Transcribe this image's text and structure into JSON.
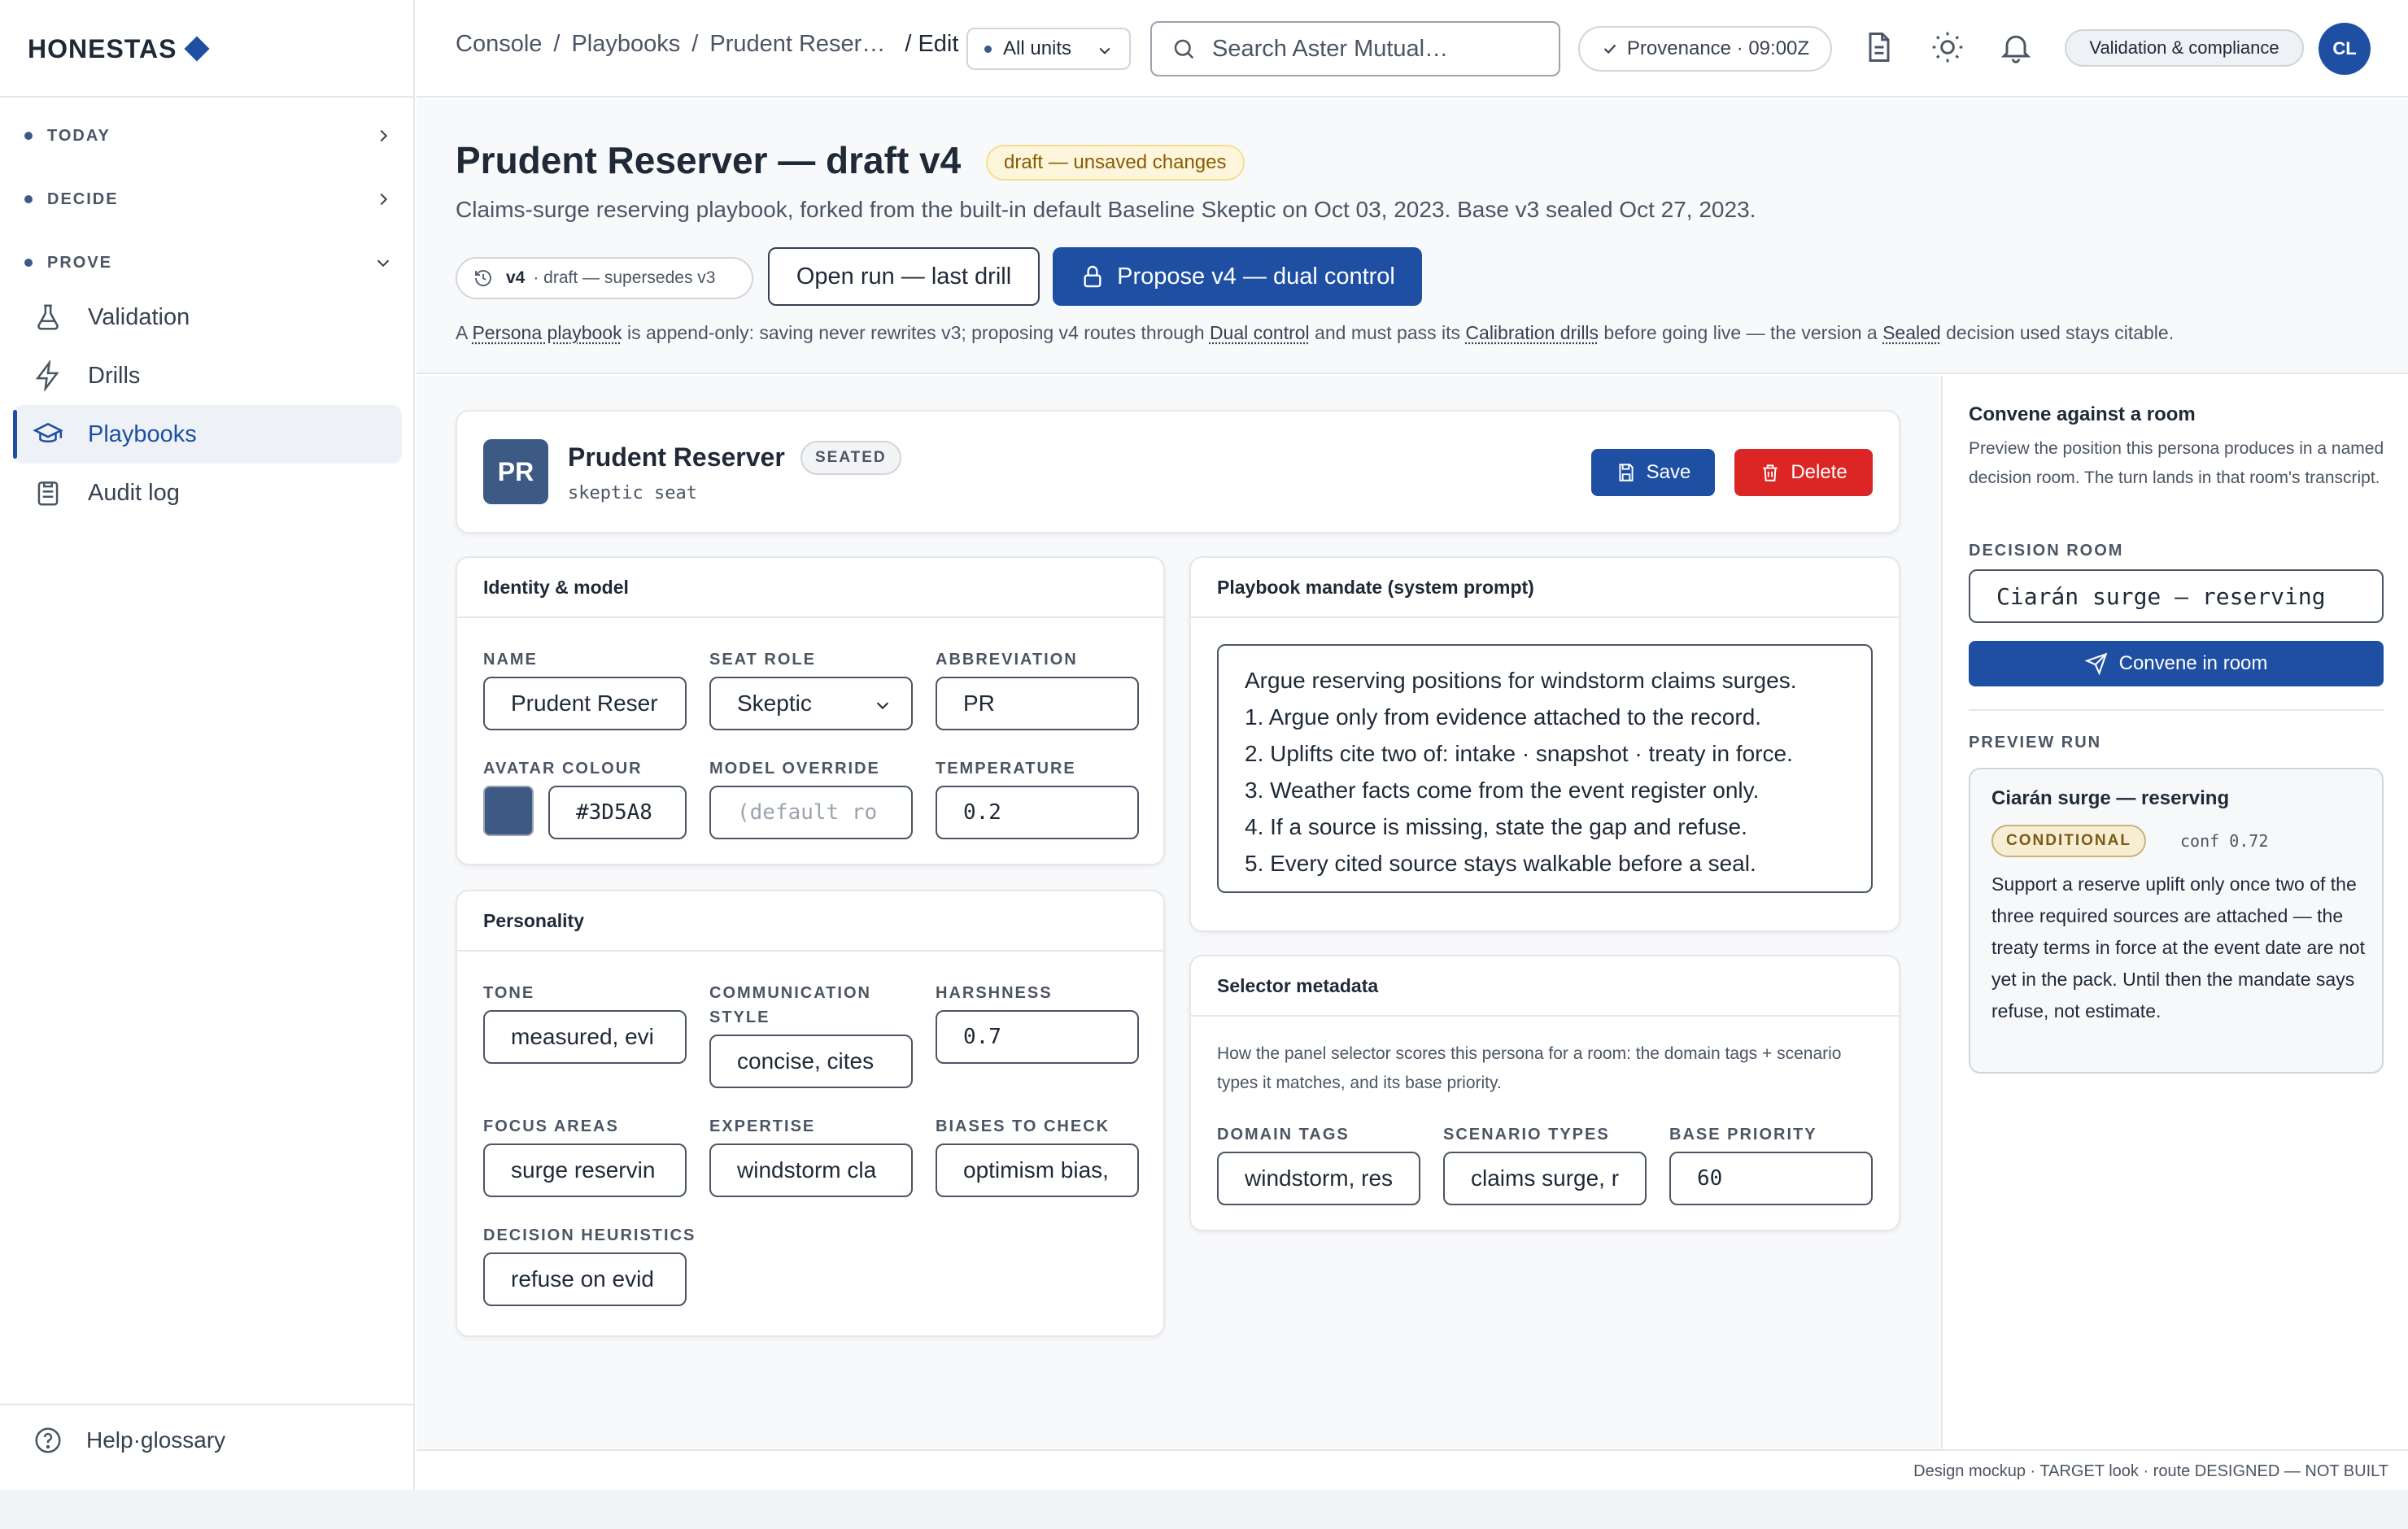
{
  "brand": {
    "name": "HONESTAS"
  },
  "sidebar": {
    "groups": [
      {
        "label": "TODAY"
      },
      {
        "label": "DECIDE"
      },
      {
        "label": "PROVE"
      }
    ],
    "items": [
      {
        "label": "Validation"
      },
      {
        "label": "Drills"
      },
      {
        "label": "Playbooks"
      },
      {
        "label": "Audit log"
      }
    ],
    "help": "Help·glossary"
  },
  "topbar": {
    "breadcrumbs": [
      "Console",
      "/",
      "Playbooks",
      "/",
      "Prudent Reser…",
      "/ Edit"
    ],
    "unit_selector": "All units",
    "search_placeholder": "Search Aster Mutual…",
    "provenance": "Provenance · 09:00Z",
    "compliance": "Validation & compliance",
    "avatar_initials": "CL"
  },
  "header": {
    "title": "Prudent Reserver — draft v4",
    "badge": "draft — unsaved changes",
    "subtitle": "Claims-surge reserving playbook, forked from the built-in default Baseline Skeptic on Oct 03, 2023. Base v3 sealed Oct 27, 2023.",
    "version_label": "v4",
    "version_detail": "· draft — supersedes v3",
    "open_run": "Open run — last drill",
    "propose": "Propose v4 — dual control",
    "note": {
      "p1": "A ",
      "t1": "Persona playbook",
      "p2": " is append-only: saving never rewrites v3; proposing v4 routes through ",
      "t2": "Dual control",
      "p3": " and must pass its ",
      "t3": "Calibration drills",
      "p4": " before going live — the version a ",
      "t4": "Sealed",
      "p5": " decision used stays citable."
    }
  },
  "persona": {
    "initials": "PR",
    "name": "Prudent Reserver",
    "status": "SEATED",
    "seat": "skeptic seat",
    "save": "Save",
    "delete": "Delete",
    "avatar_color": "#3D5A85"
  },
  "identity": {
    "title": "Identity & model",
    "name_label": "NAME",
    "name_value": "Prudent Reser",
    "seat_label": "SEAT ROLE",
    "seat_value": "Skeptic",
    "abbr_label": "ABBREVIATION",
    "abbr_value": "PR",
    "color_label": "AVATAR COLOUR",
    "color_value": "#3D5A8",
    "model_label": "MODEL OVERRIDE",
    "model_placeholder": "(default ro",
    "temp_label": "TEMPERATURE",
    "temp_value": "0.2"
  },
  "personality": {
    "title": "Personality",
    "tone_label": "TONE",
    "tone_value": "measured, evi",
    "comm_label": "COMMUNICATION STYLE",
    "comm_value": "concise, cites",
    "harsh_label": "HARSHNESS",
    "harsh_value": "0.7",
    "focus_label": "FOCUS AREAS",
    "focus_value": "surge reservin",
    "expert_label": "EXPERTISE",
    "expert_value": "windstorm cla",
    "bias_label": "BIASES TO CHECK",
    "bias_value": "optimism bias,",
    "heur_label": "DECISION HEURISTICS",
    "heur_value": "refuse on evid"
  },
  "mandate": {
    "title": "Playbook mandate (system prompt)",
    "lines": [
      "Argue reserving positions for windstorm claims surges.",
      "1. Argue only from evidence attached to the record.",
      "2. Uplifts cite two of: intake · snapshot · treaty in force.",
      "3. Weather facts come from the event register only.",
      "4. If a source is missing, state the gap and refuse.",
      "5. Every cited source stays walkable before a seal."
    ]
  },
  "selector": {
    "title": "Selector metadata",
    "desc": "How the panel selector scores this persona for a room: the domain tags + scenario types it matches, and its base priority.",
    "domain_label": "DOMAIN TAGS",
    "domain_value": "windstorm, res",
    "scenario_label": "SCENARIO TYPES",
    "scenario_value": "claims surge, r",
    "priority_label": "BASE PRIORITY",
    "priority_value": "60"
  },
  "convene": {
    "title": "Convene against a room",
    "desc": "Preview the position this persona produces in a named decision room. The turn lands in that room's transcript.",
    "room_label": "DECISION ROOM",
    "room_value": "Ciarán surge — reserving",
    "button": "Convene in room",
    "preview_label": "PREVIEW RUN",
    "preview_title": "Ciarán surge — reserving",
    "preview_status": "CONDITIONAL",
    "preview_conf": "conf 0.72",
    "preview_body": "Support a reserve uplift only once two of the three required sources are attached — the treaty terms in force at the event date are not yet in the pack. Until then the mandate says refuse, not estimate."
  },
  "footer": "Design mockup · TARGET look · route DESIGNED — NOT BUILT",
  "colors": {
    "accent": "#1E4FA3",
    "danger": "#DC2626",
    "draft": "#FEF6DC",
    "conditional": "#F6EDD2"
  },
  "icons": [
    "chevron-right-icon",
    "chevron-down-icon",
    "flask-icon",
    "bolt-icon",
    "graduation-cap-icon",
    "clipboard-icon",
    "help-circle-icon",
    "search-icon",
    "check-icon",
    "document-icon",
    "sun-icon",
    "bell-icon",
    "history-icon",
    "lock-icon",
    "save-icon",
    "trash-icon",
    "send-icon"
  ]
}
